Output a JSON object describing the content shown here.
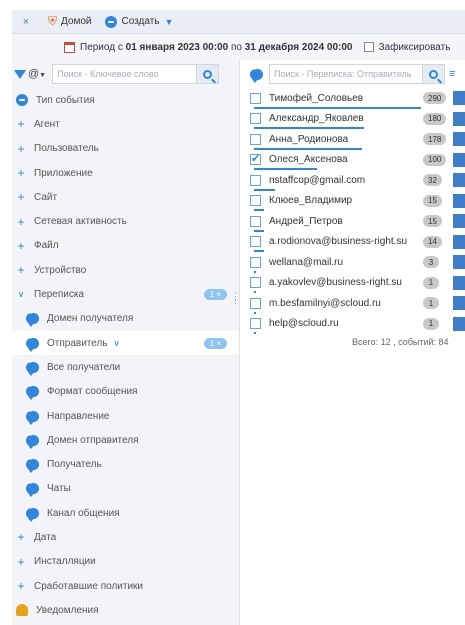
{
  "topbar": {
    "close": "×",
    "home": "Домой",
    "create": "Создать"
  },
  "period": {
    "prefix": "Период с",
    "from": "01 января 2023 00:00",
    "mid": "по",
    "to": "31 декабря 2024 00:00",
    "fix_label": "Зафиксировать"
  },
  "left": {
    "at": "@",
    "search_placeholder": "Поиск - Ключевое слово",
    "tree": [
      {
        "label": "Тип события"
      },
      {
        "label": "Агент"
      },
      {
        "label": "Пользователь"
      },
      {
        "label": "Приложение"
      },
      {
        "label": "Сайт"
      },
      {
        "label": "Сетевая активность"
      },
      {
        "label": "Файл"
      },
      {
        "label": "Устройство"
      },
      {
        "label": "Переписка",
        "badge": "1 ×"
      },
      {
        "label": "Домен получателя"
      },
      {
        "label": "Отправитель",
        "badge": "1 ×"
      },
      {
        "label": "Все получатели"
      },
      {
        "label": "Формат сообщения"
      },
      {
        "label": "Направление"
      },
      {
        "label": "Домен отправителя"
      },
      {
        "label": "Получатель"
      },
      {
        "label": "Чаты"
      },
      {
        "label": "Канал общения"
      },
      {
        "label": "Дата"
      },
      {
        "label": "Инсталляции"
      },
      {
        "label": "Сработавшие политики"
      },
      {
        "label": "Уведомления"
      }
    ]
  },
  "right": {
    "search_placeholder": "Поиск - Переписка: Отправитель",
    "rows": [
      {
        "name": "Тимофей_Соловьев",
        "count": "290",
        "share": 0.88,
        "checked": false
      },
      {
        "name": "Александр_Яковлев",
        "count": "180",
        "share": 0.58,
        "checked": false
      },
      {
        "name": "Анна_Родионова",
        "count": "178",
        "share": 0.57,
        "checked": false
      },
      {
        "name": "Олеся_Аксенова",
        "count": "100",
        "share": 0.33,
        "checked": true
      },
      {
        "name": "nstaffcop@gmail.com",
        "count": "32",
        "share": 0.11,
        "checked": false
      },
      {
        "name": "Клюев_Владимир",
        "count": "15",
        "share": 0.05,
        "checked": false
      },
      {
        "name": "Андрей_Петров",
        "count": "15",
        "share": 0.05,
        "checked": false
      },
      {
        "name": "a.rodionova@business-right.su",
        "count": "14",
        "share": 0.05,
        "checked": false
      },
      {
        "name": "wellana@mail.ru",
        "count": "3",
        "share": 0.01,
        "checked": false
      },
      {
        "name": "a.yakovlev@business-right.su",
        "count": "1",
        "share": 0.005,
        "checked": false
      },
      {
        "name": "m.besfamilnyi@scloud.ru",
        "count": "1",
        "share": 0.005,
        "checked": false
      },
      {
        "name": "help@scloud.ru",
        "count": "1",
        "share": 0.005,
        "checked": false
      }
    ],
    "total": "Всего: 12 , событий: 84"
  }
}
